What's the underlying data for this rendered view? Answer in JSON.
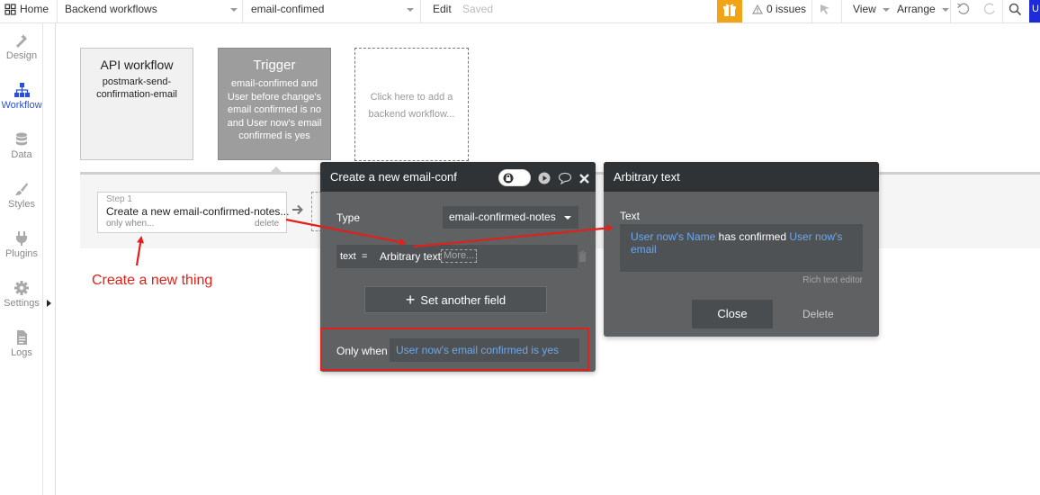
{
  "topbar": {
    "home": "Home",
    "page_select": "Backend workflows",
    "workflow_select": "email-confimed",
    "edit": "Edit",
    "saved": "Saved",
    "issues": "0 issues",
    "view": "View",
    "arrange": "Arrange",
    "user_initial": "U"
  },
  "sidebar": {
    "items": [
      {
        "label": "Design",
        "icon": "design-icon"
      },
      {
        "label": "Workflow",
        "icon": "workflow-icon"
      },
      {
        "label": "Data",
        "icon": "data-icon"
      },
      {
        "label": "Styles",
        "icon": "styles-icon"
      },
      {
        "label": "Plugins",
        "icon": "plugins-icon"
      },
      {
        "label": "Settings",
        "icon": "settings-icon"
      },
      {
        "label": "Logs",
        "icon": "logs-icon"
      }
    ]
  },
  "cards": {
    "api": {
      "title": "API workflow",
      "sub": "postmark-send-confirmation-email"
    },
    "trigger": {
      "title": "Trigger",
      "sub": "email-confimed and User before change's email confirmed is no and User now's email confirmed is yes"
    },
    "add": {
      "text": "Click here to add a backend workflow..."
    }
  },
  "step": {
    "number": "Step 1",
    "title": "Create a new email-confirmed-notes...",
    "only_when": "only when...",
    "delete": "delete"
  },
  "annotation": {
    "text": "Create a new thing"
  },
  "create_panel": {
    "title": "Create a new email-conf",
    "type_label": "Type",
    "type_value": "email-confirmed-notes",
    "field_key": "text",
    "field_eq": "=",
    "field_value": "Arbitrary text",
    "field_more": "More...",
    "set_another": "Set another field",
    "only_when_label": "Only when",
    "only_when_value": "User now's email confirmed is yes"
  },
  "arbitrary_panel": {
    "title": "Arbitrary text",
    "text_label": "Text",
    "expr_part1": "User now's Name",
    "expr_part2": " has confirmed ",
    "expr_part3": "User now's email",
    "rich_text": "Rich text editor",
    "close": "Close",
    "delete": "Delete"
  },
  "colors": {
    "accent": "#2d4fd6",
    "annotation_red": "#e0201b",
    "panel_dark": "#2f3335",
    "panel_body": "#5f6163",
    "link_blue": "#6aa8f0",
    "gift_orange": "#f2a417"
  }
}
